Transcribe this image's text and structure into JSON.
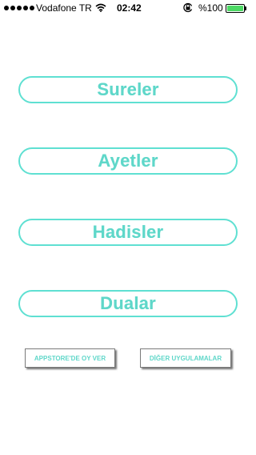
{
  "status_bar": {
    "carrier": "Vodafone TR",
    "time": "02:42",
    "battery_percent": "%100",
    "signal_strength": 5,
    "icons": [
      "signal-dots-icon",
      "wifi-icon",
      "orientation-lock-icon",
      "battery-icon"
    ],
    "battery_color": "#4cd964"
  },
  "menu": {
    "items": [
      {
        "label": "Sureler"
      },
      {
        "label": "Ayetler"
      },
      {
        "label": "Hadisler"
      },
      {
        "label": "Dualar"
      }
    ],
    "accent_color": "#5fd7c9"
  },
  "footer": {
    "rate_label": "APPSTORE'DE OY VER",
    "other_apps_label": "DİĞER UYGULAMALAR"
  }
}
